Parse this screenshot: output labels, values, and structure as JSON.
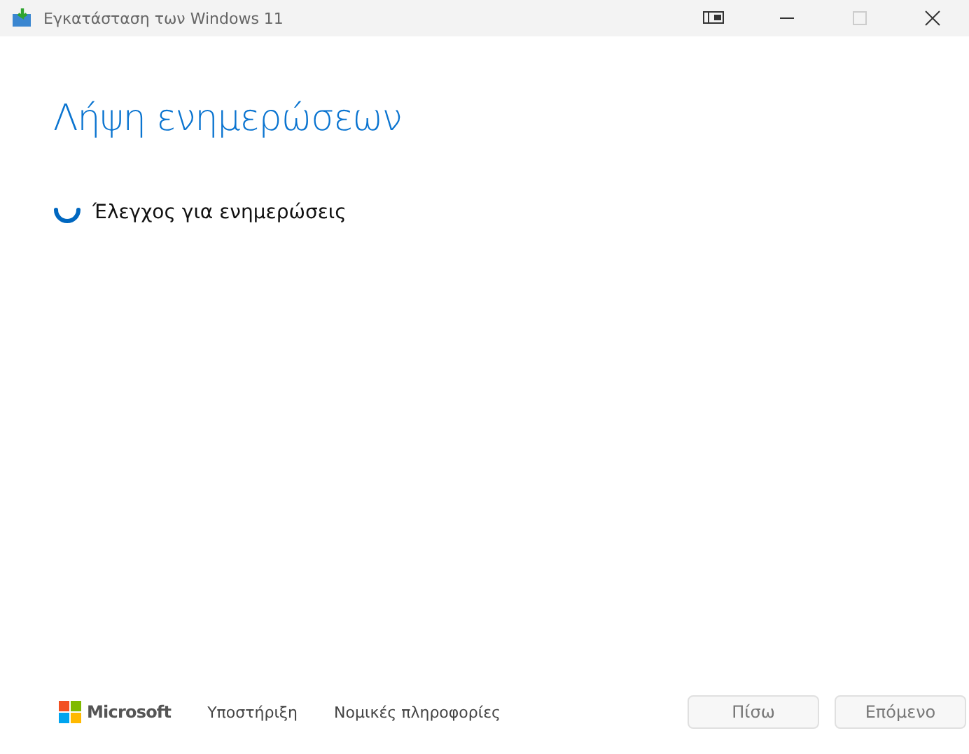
{
  "window": {
    "title": "Εγκατάσταση των Windows 11",
    "controls": [
      {
        "kind": "snap",
        "disabled": false
      },
      {
        "kind": "minimize",
        "disabled": false
      },
      {
        "kind": "maximize",
        "disabled": true
      },
      {
        "kind": "close",
        "disabled": false
      }
    ]
  },
  "heading": "Λήψη ενημερώσεων",
  "status": {
    "text": "Έλεγχος για ενημερώσεις"
  },
  "footer": {
    "brand": "Microsoft",
    "links": [
      "Υποστήριξη",
      "Νομικές πληροφορίες"
    ]
  },
  "buttons": [
    {
      "label": "Πίσω",
      "disabled": true
    },
    {
      "label": "Επόμενο",
      "disabled": true
    }
  ]
}
